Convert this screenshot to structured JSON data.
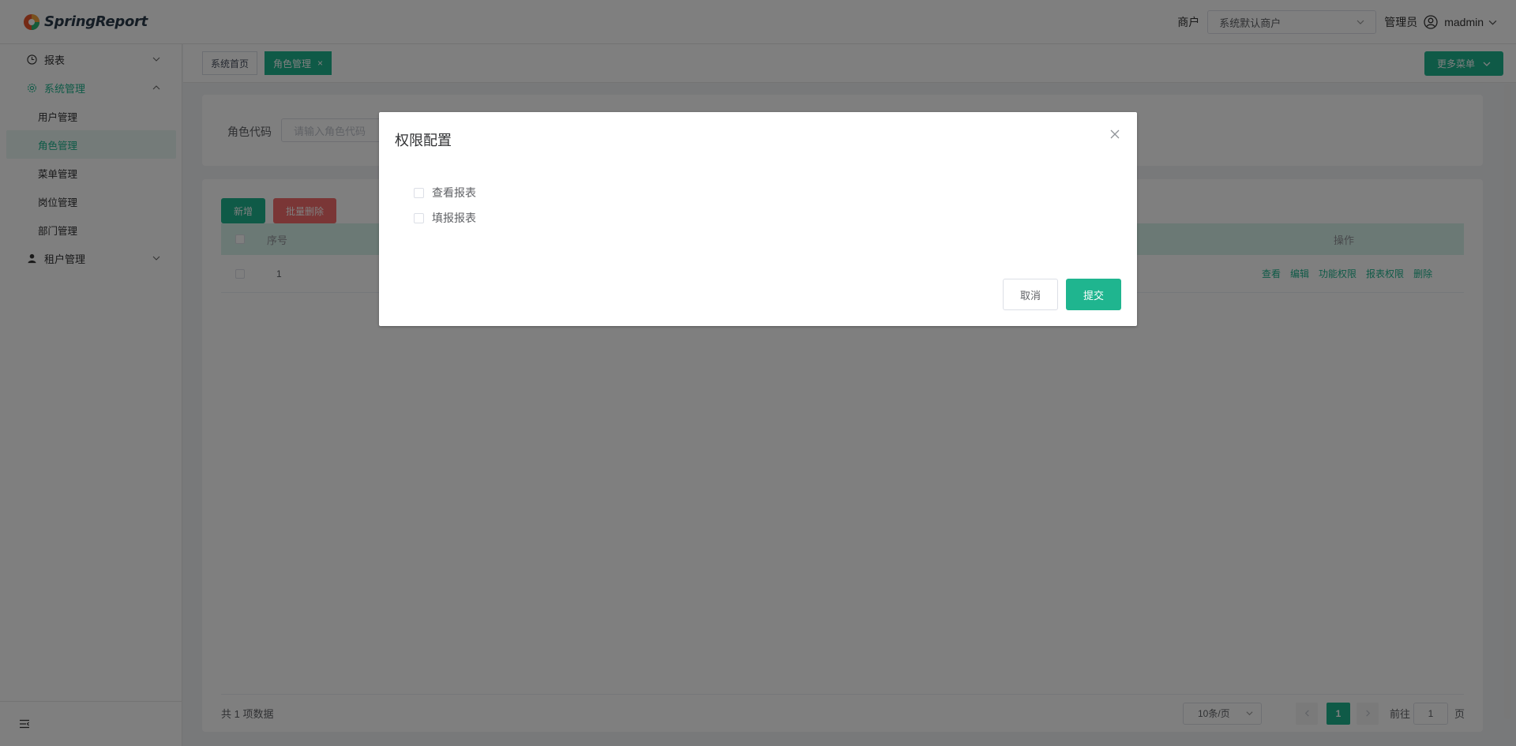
{
  "brand": {
    "name": "SpringReport"
  },
  "header": {
    "tenant_label": "商户",
    "tenant_value": "系统默认商户",
    "role": "管理员",
    "user_name": "madmin"
  },
  "sidebar": {
    "items": [
      {
        "label": "报表",
        "icon": "clock-icon"
      },
      {
        "label": "系统管理",
        "icon": "gear-icon"
      },
      {
        "label": "租户管理",
        "icon": "person-icon"
      }
    ],
    "sub_items": [
      {
        "label": "用户管理"
      },
      {
        "label": "角色管理"
      },
      {
        "label": "菜单管理"
      },
      {
        "label": "岗位管理"
      },
      {
        "label": "部门管理"
      }
    ]
  },
  "tabs": [
    {
      "label": "系统首页"
    },
    {
      "label": "角色管理",
      "close": "×"
    }
  ],
  "more_menu": "更多菜单",
  "search": {
    "label": "角色代码",
    "placeholder": "请输入角色代码"
  },
  "toolbar": {
    "add": "新增",
    "batch_delete": "批量删除"
  },
  "table": {
    "headers": {
      "seq": "序号",
      "ops": "操作"
    },
    "rows": [
      {
        "seq": "1"
      }
    ],
    "ops": [
      "查看",
      "编辑",
      "功能权限",
      "报表权限",
      "删除"
    ]
  },
  "pager": {
    "total": "共 1 项数据",
    "page_size": "10条/页",
    "current": "1",
    "goto_label": "前往",
    "goto_value": "1",
    "goto_suffix": "页"
  },
  "dialog": {
    "title": "权限配置",
    "permissions": [
      "查看报表",
      "填报报表"
    ],
    "cancel": "取消",
    "submit": "提交"
  },
  "colors": {
    "accent": "#1fb58f",
    "danger": "#f56c6c"
  }
}
